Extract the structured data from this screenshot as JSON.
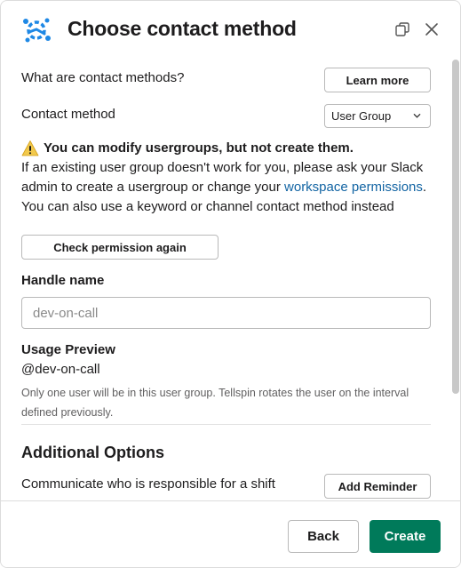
{
  "header": {
    "title": "Choose contact method",
    "logo_icon": "tellspin-logo-icon",
    "popout_icon": "popout-icon",
    "close_icon": "close-icon"
  },
  "contact_methods": {
    "question": "What are contact methods?",
    "learn_more_label": "Learn more",
    "method_label": "Contact method",
    "method_selected": "User Group"
  },
  "warning": {
    "icon": "warning-icon",
    "heading": "You can modify usergroups, but not create them.",
    "line1": "If an existing user group doesn't work for you, please ask your Slack admin to create a usergroup or change your ",
    "link_text": "workspace permissions",
    "line1_end": ".",
    "line2": "You can also use a keyword or channel contact method instead"
  },
  "check_permission_label": "Check permission again",
  "handle": {
    "label": "Handle name",
    "placeholder": "dev-on-call"
  },
  "usage_preview": {
    "label": "Usage Preview",
    "value": "@dev-on-call",
    "note": "Only one user will be in this user group. Tellspin rotates the user on the interval defined previously."
  },
  "additional_options": {
    "title": "Additional Options",
    "shift_text": "Communicate who is responsible for a shift",
    "add_reminder_label": "Add Reminder"
  },
  "footer": {
    "back_label": "Back",
    "create_label": "Create"
  },
  "colors": {
    "accent": "#007a5a",
    "link": "#1264a3",
    "logo_blue": "#1e88e5"
  }
}
